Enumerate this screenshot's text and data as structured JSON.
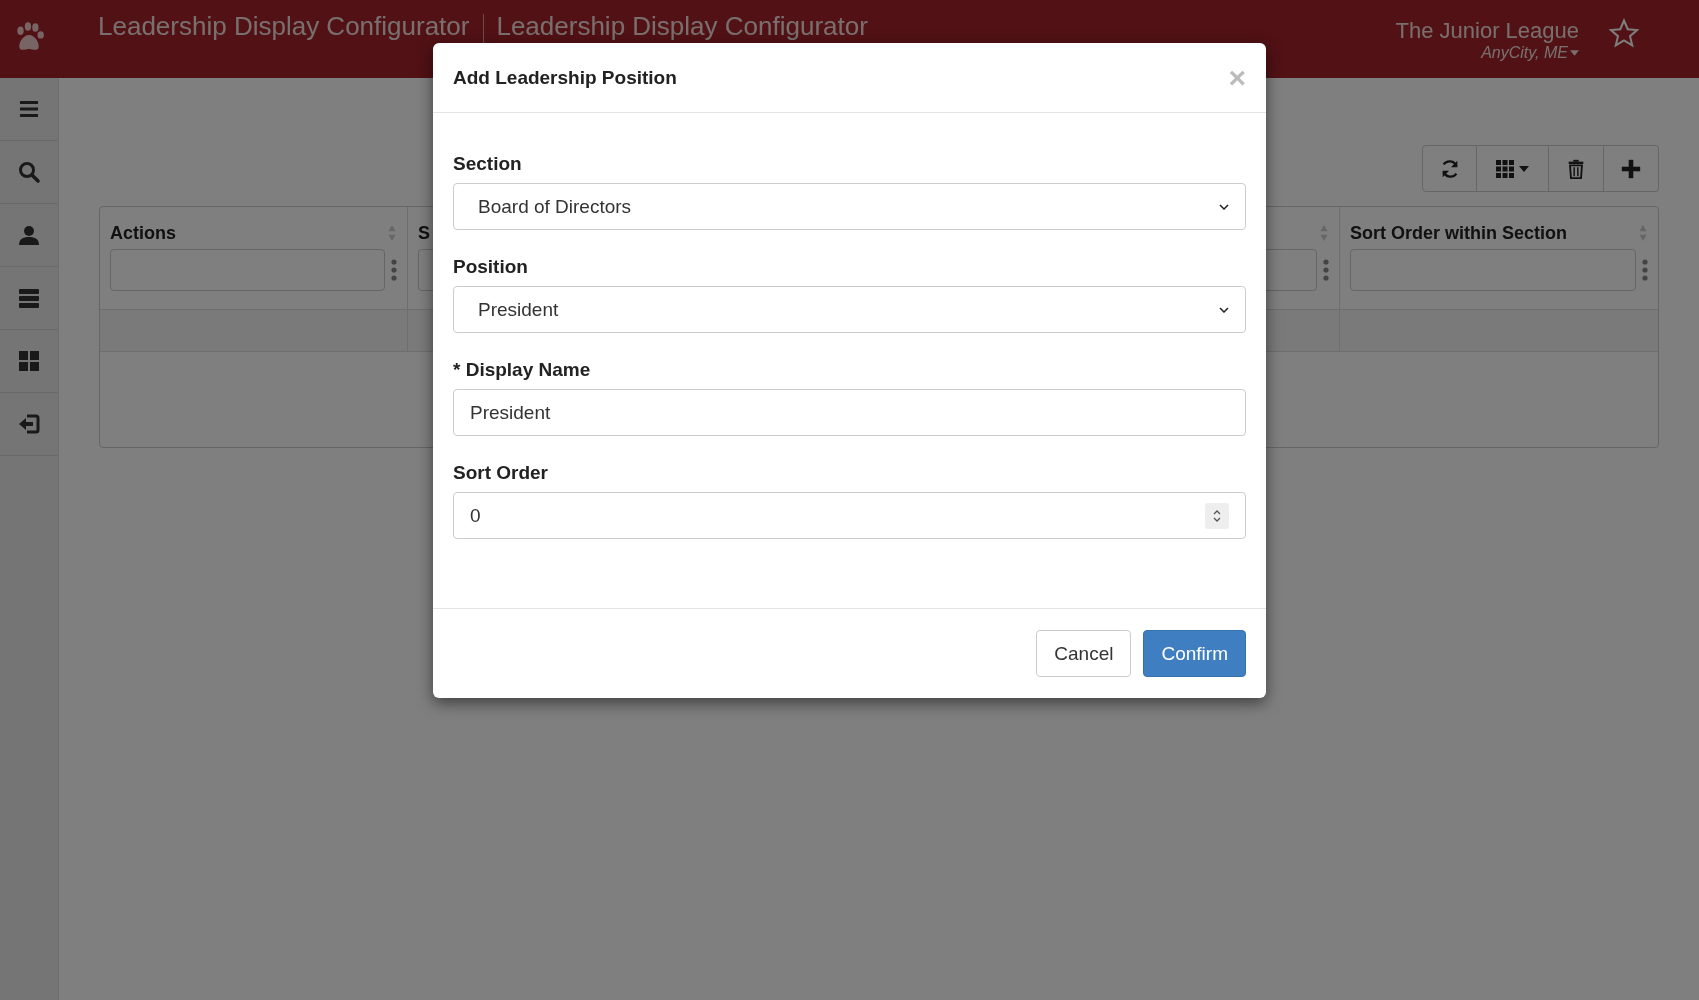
{
  "header": {
    "title": "Leadership Display Configurator",
    "subtitle": "Leadership Display Configurator",
    "organization": "The Junior League",
    "location": "AnyCity, ME"
  },
  "sidebar": {
    "items": [
      {
        "kind": "menu"
      },
      {
        "kind": "search"
      },
      {
        "kind": "user"
      },
      {
        "kind": "list"
      },
      {
        "kind": "grid"
      },
      {
        "kind": "logout"
      }
    ]
  },
  "toolbar": {
    "buttons": [
      {
        "kind": "refresh"
      },
      {
        "kind": "columns"
      },
      {
        "kind": "delete"
      },
      {
        "kind": "add"
      }
    ]
  },
  "table": {
    "columns": [
      {
        "label": "Actions"
      },
      {
        "label": "S"
      },
      {},
      {
        "label": "Sort Order within Section"
      }
    ]
  },
  "modal": {
    "title": "Add Leadership Position",
    "close": "×",
    "fields": [
      {
        "kind": "select",
        "label": "Section",
        "value": "Board of Directors"
      },
      {
        "kind": "select",
        "label": "Position",
        "value": "President"
      },
      {
        "kind": "text",
        "label": "* Display Name",
        "value": "President"
      },
      {
        "kind": "number",
        "label": "Sort Order",
        "value": "0"
      }
    ],
    "buttons": [
      {
        "label": "Cancel",
        "primary": false
      },
      {
        "label": "Confirm",
        "primary": true
      }
    ]
  }
}
